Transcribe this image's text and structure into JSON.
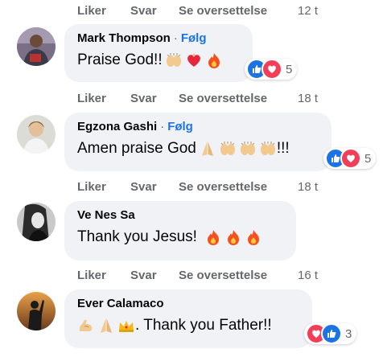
{
  "action_labels": {
    "like": "Liker",
    "reply": "Svar",
    "translate": "Se oversettelse"
  },
  "rows": [
    {
      "time": "12 t"
    },
    {
      "time": "18 t"
    },
    {
      "time": "18 t"
    },
    {
      "time": "16 t"
    }
  ],
  "comments": [
    {
      "author": "Mark Thompson",
      "follow": "Følg",
      "text": "Praise God!!",
      "emojis": [
        "hands-icon",
        "heart-icon",
        "fire-icon"
      ],
      "reaction_count": "5"
    },
    {
      "author": "Egzona Gashi",
      "follow": "Følg",
      "text": "Amen praise God",
      "text_suffix": "!!!",
      "emojis": [
        "pray-icon",
        "hands-icon",
        "hands-icon",
        "hands-icon"
      ],
      "reaction_count": "5"
    },
    {
      "author": "Ve Nes Sa",
      "text": "Thank you Jesus!",
      "emojis": [
        "fire-icon",
        "fire-icon",
        "fire-icon"
      ]
    },
    {
      "author": "Ever Calamaco",
      "text": ". Thank you Father!!",
      "emojis_before": [
        "muscle-icon",
        "pray-icon",
        "crown-icon"
      ],
      "reaction_count": "3"
    }
  ],
  "colors": {
    "accent": "#1b74e4",
    "secondary_text": "#65676b",
    "bubble": "#f0f2f5",
    "love": "#f33e58"
  }
}
